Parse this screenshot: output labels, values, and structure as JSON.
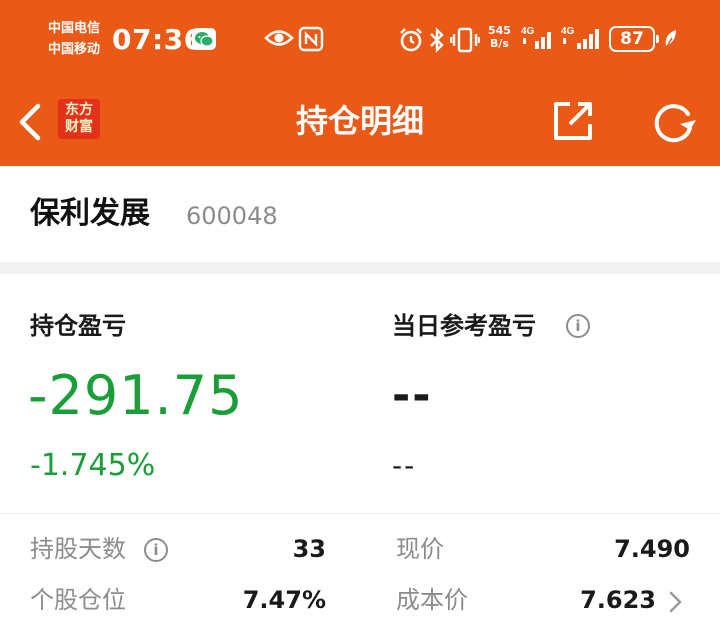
{
  "status_bar": {
    "carrier_1": "中国电信",
    "carrier_2": "中国移动",
    "time": "07:36",
    "net_speed_value": "545",
    "net_speed_unit": "B/s",
    "network_1": "4G",
    "network_2": "4G",
    "battery": "87"
  },
  "header": {
    "logo_line1": "东方",
    "logo_line2": "财富",
    "title": "持仓明细"
  },
  "stock": {
    "name": "保利发展",
    "code": "600048"
  },
  "position": {
    "pnl_label": "持仓盈亏",
    "pnl_value": "-291.75",
    "pnl_percent": "-1.745%",
    "daily_label": "当日参考盈亏",
    "daily_value": "--",
    "daily_percent": "--"
  },
  "details": {
    "days_label": "持股天数",
    "days_value": "33",
    "price_label": "现价",
    "price_value": "7.490",
    "weight_label": "个股仓位",
    "weight_value": "7.47%",
    "cost_label": "成本价",
    "cost_value": "7.623"
  },
  "colors": {
    "header_bg": "#ea5a16",
    "loss_green": "#1a9e37",
    "logo_red": "#e3311b"
  },
  "icons": {
    "back": "chevron-left-icon",
    "share": "share-icon",
    "refresh": "refresh-icon",
    "info": "info-icon",
    "detail": "chevron-right-icon"
  }
}
